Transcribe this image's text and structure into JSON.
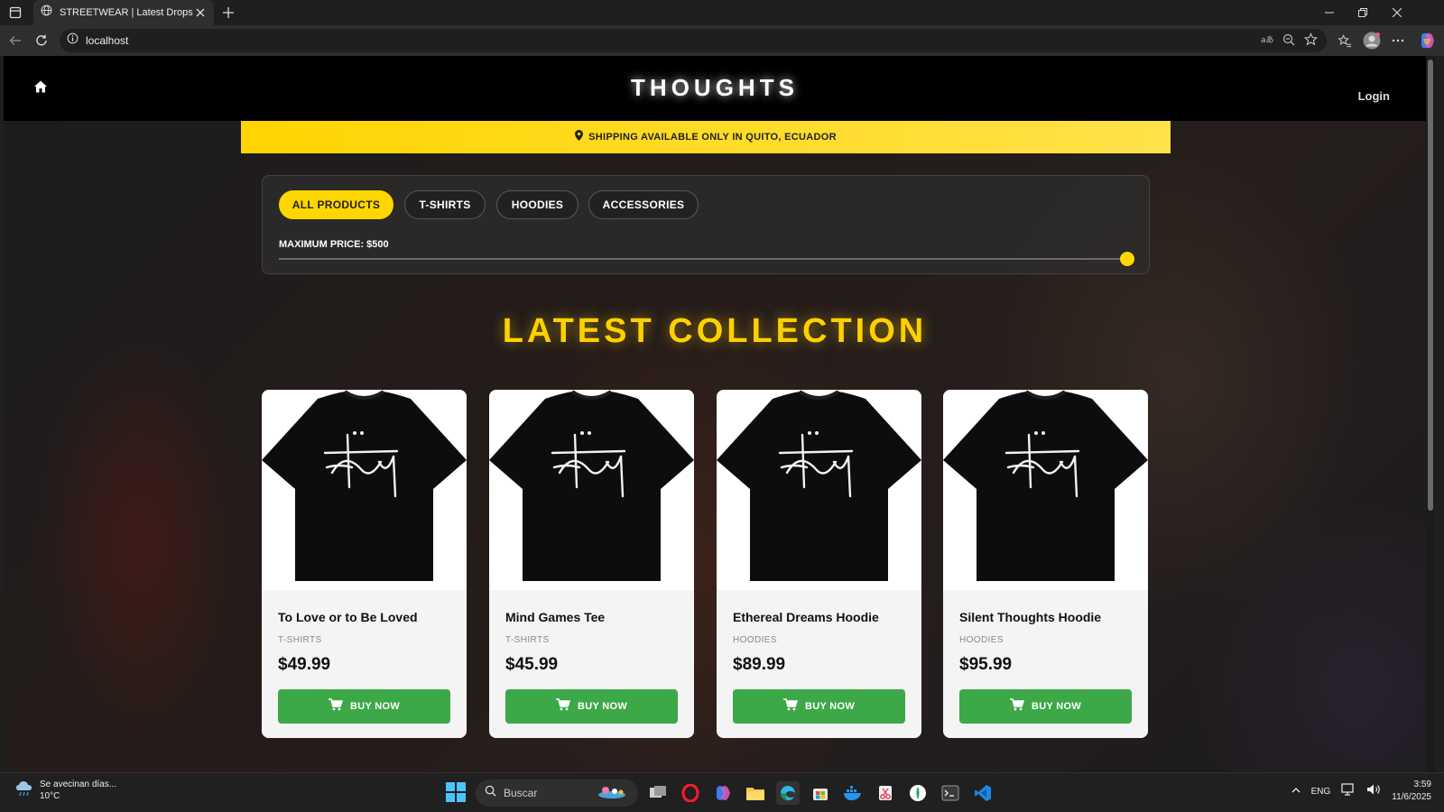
{
  "browser": {
    "tab_title": "STREETWEAR | Latest Drops",
    "url": "localhost"
  },
  "site": {
    "brand": "THOUGHTS",
    "login_label": "Login",
    "shipping_notice": "SHIPPING AVAILABLE ONLY IN QUITO, ECUADOR"
  },
  "filters": {
    "categories": [
      {
        "label": "ALL PRODUCTS",
        "active": true
      },
      {
        "label": "T-SHIRTS",
        "active": false
      },
      {
        "label": "HOODIES",
        "active": false
      },
      {
        "label": "ACCESSORIES",
        "active": false
      }
    ],
    "price_label": "MAXIMUM PRICE: $500",
    "price_max": 500,
    "price_value": 500
  },
  "section_title": "LATEST COLLECTION",
  "products": [
    {
      "name": "To Love or to Be Loved",
      "category": "T-SHIRTS",
      "price": "$49.99",
      "button": "BUY NOW"
    },
    {
      "name": "Mind Games Tee",
      "category": "T-SHIRTS",
      "price": "$45.99",
      "button": "BUY NOW"
    },
    {
      "name": "Ethereal Dreams Hoodie",
      "category": "HOODIES",
      "price": "$89.99",
      "button": "BUY NOW"
    },
    {
      "name": "Silent Thoughts Hoodie",
      "category": "HOODIES",
      "price": "$95.99",
      "button": "BUY NOW"
    }
  ],
  "taskbar": {
    "weather_line1": "Se avecinan días...",
    "weather_line2": "10°C",
    "search_placeholder": "Buscar",
    "language": "ENG",
    "time": "3:59",
    "date": "11/6/2025"
  },
  "colors": {
    "accent_yellow": "#ffd700",
    "buy_green": "#3da847",
    "header_black": "#000000"
  }
}
